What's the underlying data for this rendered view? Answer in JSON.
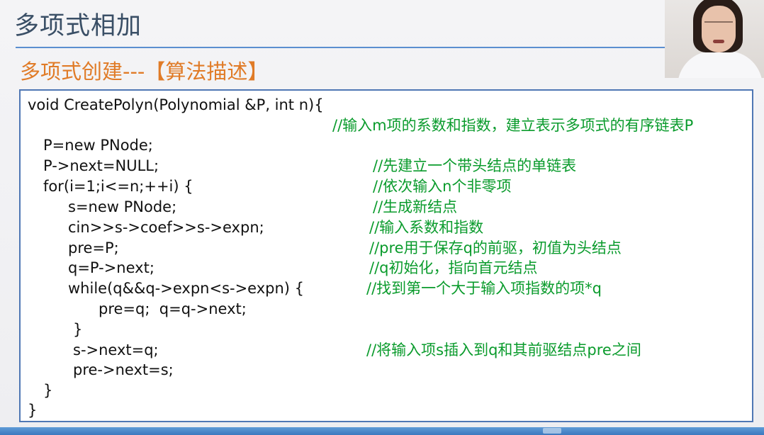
{
  "slide": {
    "title": "多项式相加",
    "section_heading": "多项式创建---【算法描述】"
  },
  "code": {
    "lines": [
      {
        "code": "void CreatePolyn(Polynomial &P, int n){",
        "comment": ""
      },
      {
        "code": "",
        "comment": "//输入m项的系数和指数，建立表示多项式的有序链表P"
      },
      {
        "code": "P=new PNode;",
        "comment": ""
      },
      {
        "code": "P->next=NULL;",
        "comment": "//先建立一个带头结点的单链表"
      },
      {
        "code": "for(i=1;i<=n;++i) {",
        "comment": "//依次输入n个非零项"
      },
      {
        "code": "s=new PNode;",
        "comment": "//生成新结点"
      },
      {
        "code": "cin>>s->coef>>s->expn;",
        "comment": "//输入系数和指数"
      },
      {
        "code": "pre=P;",
        "comment": "//pre用于保存q的前驱，初值为头结点"
      },
      {
        "code": "q=P->next;",
        "comment": "//q初始化，指向首元结点"
      },
      {
        "code": "while(q&&q->expn<s->expn) {",
        "comment": "//找到第一个大于输入项指数的项*q"
      },
      {
        "code": "pre=q;  q=q->next;",
        "comment": ""
      },
      {
        "code": "}",
        "comment": ""
      },
      {
        "code": "s->next=q;",
        "comment": "//将输入项s插入到q和其前驱结点pre之间"
      },
      {
        "code": "pre->next=s;",
        "comment": ""
      },
      {
        "code": "}",
        "comment": ""
      },
      {
        "code": "}",
        "comment": ""
      }
    ]
  },
  "colors": {
    "title": "#3a4f66",
    "heading_accent": "#e07b27",
    "comment": "#0a9b2c",
    "box_border": "#4f77b4",
    "rule": "#5b8fd0"
  }
}
